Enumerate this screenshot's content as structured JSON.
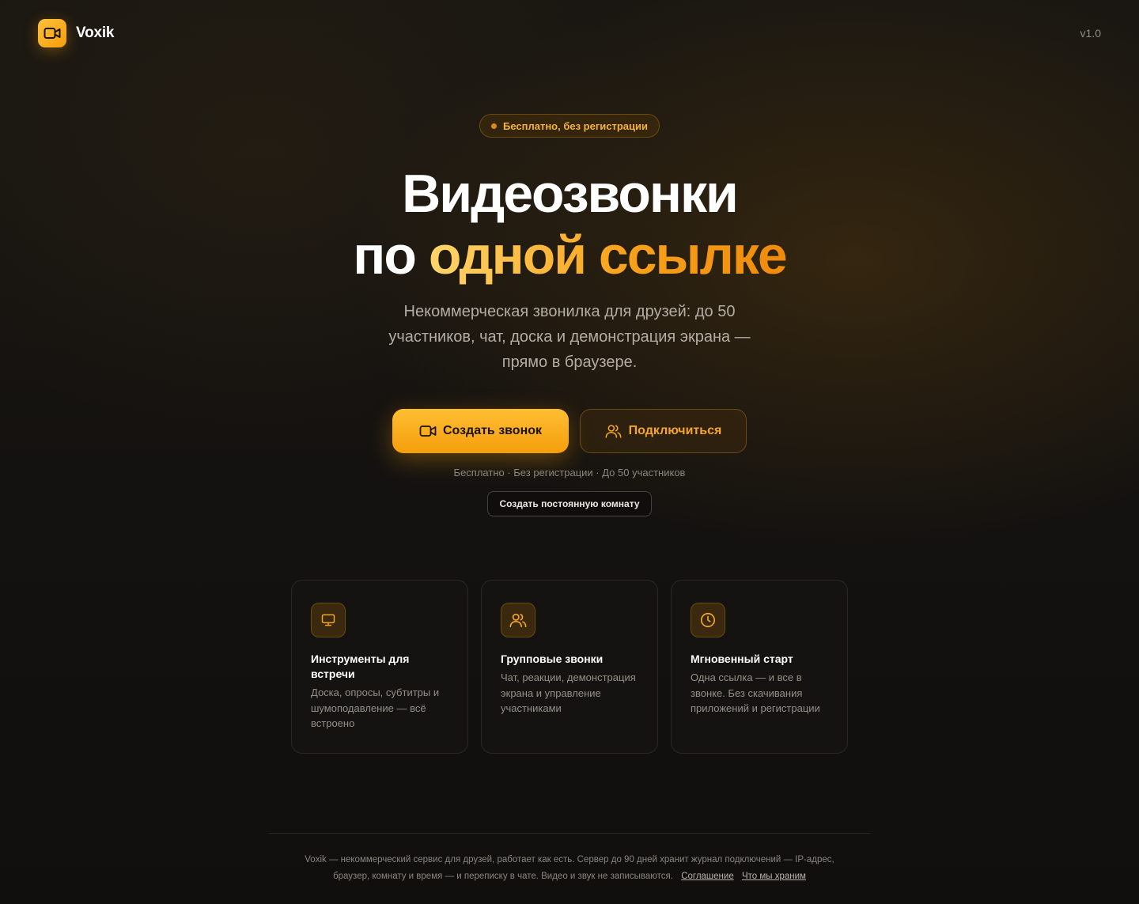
{
  "header": {
    "brand": "Voxik",
    "version": "v1.0"
  },
  "hero": {
    "badge": "Бесплатно, без регистрации",
    "title_line1": "Видеозвонки",
    "title_line2_plain": "по",
    "title_line2_accent": "одной ссылке",
    "subtitle": "Некоммерческая звонилка для друзей: до 50 участников, чат, доска и демонстрация экрана — прямо в браузере."
  },
  "cta": {
    "create_label": "Создать звонок",
    "join_label": "Подключиться",
    "note": "Бесплатно · Без регистрации · До 50 участников",
    "permanent_room_label": "Создать постоянную комнату"
  },
  "features": [
    {
      "icon": "monitor-icon",
      "title": "Инструменты для встречи",
      "description": "Доска, опросы, субтитры и шумоподавление — всё встроено"
    },
    {
      "icon": "users-icon",
      "title": "Групповые звонки",
      "description": "Чат, реакции, демонстрация экрана и управление участниками"
    },
    {
      "icon": "clock-icon",
      "title": "Мгновенный старт",
      "description": "Одна ссылка — и все в звонке. Без скачивания приложений и регистрации"
    }
  ],
  "footer": {
    "text": "Voxik — некоммерческий сервис для друзей, работает как есть. Сервер до 90 дней хранит журнал подключений — IP-адрес, браузер, комнату и время — и переписку в чате. Видео и звук не записываются.",
    "link_agreement": "Соглашение",
    "link_what_we_store": "Что мы храним"
  },
  "colors": {
    "accent": "#f59e0b",
    "accent_light": "#ffc03a",
    "background": "#141210",
    "muted_text": "#8a857d"
  }
}
